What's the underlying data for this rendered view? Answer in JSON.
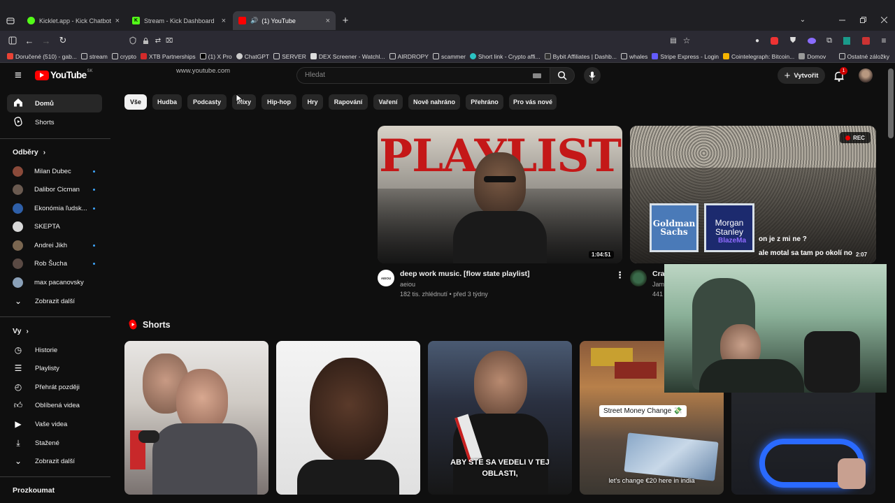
{
  "browser": {
    "tabs": [
      {
        "title": "Kicklet.app - Kick Chatbot and (",
        "close": "×"
      },
      {
        "title": "Stream - Kick Dashboard",
        "close": "×"
      },
      {
        "title": "(1) YouTube",
        "close": "×"
      }
    ],
    "new_tab": "+",
    "url": "www.youtube.com",
    "bookmarks": [
      "Doručené (510) - gab...",
      "stream",
      "crypto",
      "XTB Partnerships",
      "(1) X Pro",
      "ChatGPT",
      "SERVER",
      "DEX Screener - Watchl...",
      "AIRDROPY",
      "scammer",
      "Short link - Crypto affi...",
      "Bybit Affiliates | Dashb...",
      "whales",
      "Stripe Express - Login",
      "Cointelegraph: Bitcoin...",
      "Domov"
    ],
    "other_bookmarks": "Ostatné záložky"
  },
  "header": {
    "logo": "YouTube",
    "country": "SK",
    "search_placeholder": "Hledat",
    "create_label": "Vytvořit",
    "notif_count": "1"
  },
  "sidebar": {
    "home": "Domů",
    "shorts": "Shorts",
    "subs_title": "Odběry",
    "subs": [
      {
        "name": "Milan Dubec",
        "color": "#8a4a3a"
      },
      {
        "name": "Dalibor Cicman",
        "color": "#6a5a50"
      },
      {
        "name": "Ekonómia ľudsk...",
        "color": "#2e5fa8"
      },
      {
        "name": "SKEPTA",
        "color": "#d8d8d8"
      },
      {
        "name": "Andrei Jikh",
        "color": "#7a6650"
      },
      {
        "name": "Rob Šucha",
        "color": "#5a4a44"
      },
      {
        "name": "max pacanovsky",
        "color": "#8aa0b8"
      }
    ],
    "show_more": "Zobrazit další",
    "you_title": "Vy",
    "you_items": [
      "Historie",
      "Playlisty",
      "Přehrát později",
      "Oblíbená videa",
      "Vaše videa",
      "Stažené",
      "Zobrazit další"
    ],
    "explore_title": "Prozkoumat"
  },
  "chips": [
    "Vše",
    "Hudba",
    "Podcasty",
    "Mixy",
    "Hip-hop",
    "Hry",
    "Rapování",
    "Vaření",
    "Nově nahráno",
    "Přehráno",
    "Pro vás nové"
  ],
  "videos": [
    {
      "thumb_text": "PLAYLIST",
      "duration": "1:04:51",
      "title": "deep work music. [flow state playlist]",
      "channel": "aeiou",
      "channel_avatar_text": "AEIOU",
      "meta": "182 tis. zhlédnutí • před 3 týdny"
    },
    {
      "badge": "REC",
      "duration": "2:07",
      "title_partial": "Cra",
      "channel_partial": "Jam",
      "meta_partial": "441",
      "card1": "Goldman Sachs",
      "card2": "Morgan Stanley",
      "wm": "BlazeMa",
      "cap1": "on je z mi ne ?",
      "cap2": "ale motal sa tam po okolí no"
    }
  ],
  "shorts": {
    "title": "Shorts",
    "captions": [
      "ABY STE SA VEDELI V TEJ OBLASTI,",
      "Street Money Change 💸",
      "let's change €20 here in india"
    ]
  }
}
